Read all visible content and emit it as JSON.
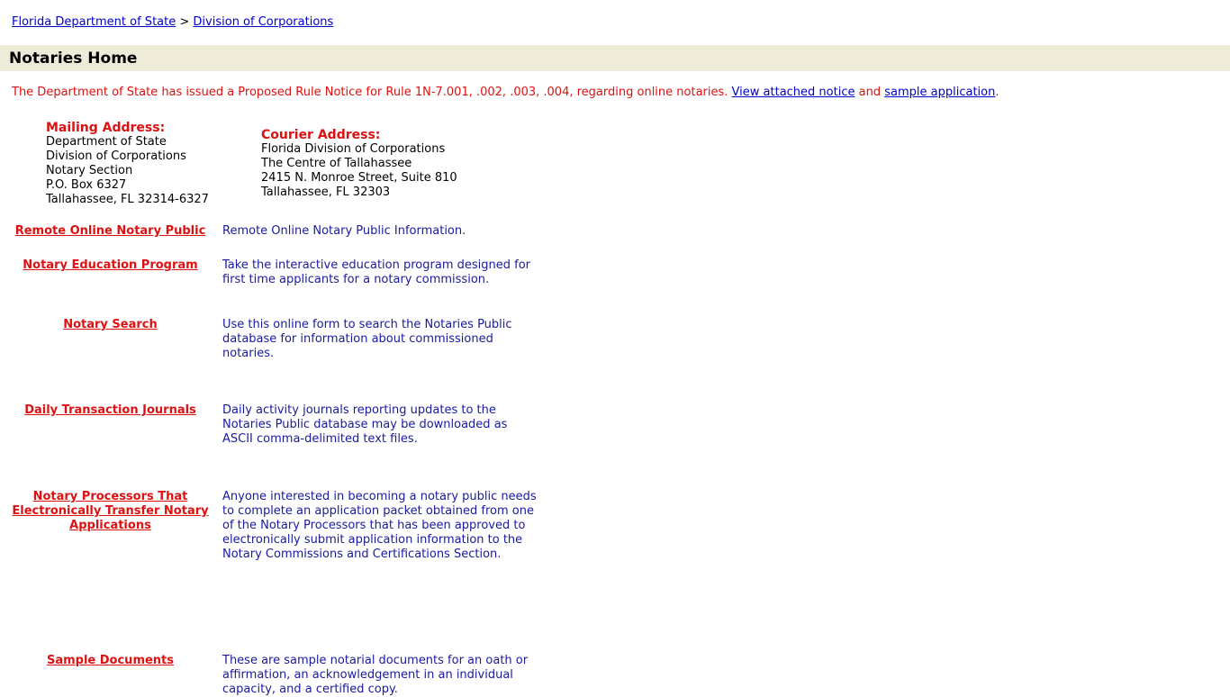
{
  "breadcrumb": {
    "home": "Florida Department of State",
    "separator": ">",
    "current": "Division of Corporations"
  },
  "page": {
    "title": "Notaries Home"
  },
  "notice": {
    "text": "The Department of State has issued a Proposed Rule Notice for Rule 1N-7.001, .002, .003, .004, regarding online notaries.",
    "link1": "View attached notice",
    "connector": "and",
    "link2": "sample application",
    "end": "."
  },
  "mailing": {
    "heading": "Mailing Address:",
    "lines": [
      "Department of State",
      "Division of Corporations",
      "Notary Section",
      "P.O. Box 6327",
      "Tallahassee, FL 32314-6327"
    ]
  },
  "courier": {
    "heading": "Courier Address:",
    "lines": [
      "Florida Division of Corporations",
      "The Centre of Tallahassee",
      "2415 N. Monroe Street, Suite 810",
      "Tallahassee, FL 32303"
    ]
  },
  "sections": [
    {
      "link": "Remote Online Notary Public",
      "desc": "Remote Online Notary Public Information."
    },
    {
      "link": "Notary Education Program",
      "desc": "Take the interactive education program designed for first time applicants for a notary commission."
    },
    {
      "link": "Notary Search",
      "desc": "Use this online form to search the Notaries Public database for information about commissioned notaries."
    },
    {
      "link": "Daily Transaction Journals",
      "desc": "Daily activity journals reporting updates to the Notaries Public database may be downloaded as ASCII comma-delimited text files."
    },
    {
      "link": "Notary Processors That Electronically Transfer Notary Applications",
      "desc": "Anyone interested in becoming a notary public needs to complete an application packet obtained from one of the Notary Processors that has been approved to electronically submit application information to the Notary Commissions and Certifications Section."
    },
    {
      "link": "Sample Documents",
      "desc": "These are sample notarial documents for an oath or affirmation, an acknowledgement in an individual capacity, and a certified copy."
    }
  ]
}
